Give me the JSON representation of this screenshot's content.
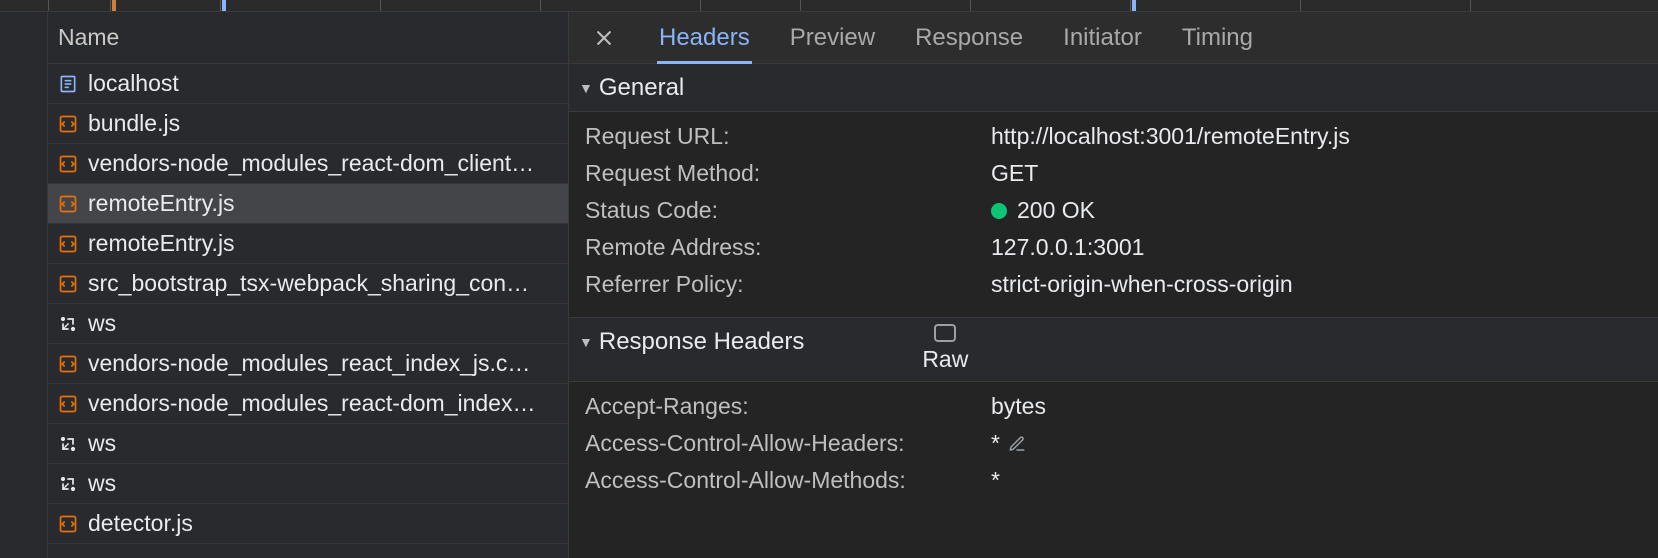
{
  "namePanel": {
    "header": "Name",
    "items": [
      {
        "label": "localhost",
        "icon": "doc",
        "selected": false
      },
      {
        "label": "bundle.js",
        "icon": "script",
        "selected": false
      },
      {
        "label": "vendors-node_modules_react-dom_client…",
        "icon": "script",
        "selected": false
      },
      {
        "label": "remoteEntry.js",
        "icon": "script",
        "selected": true
      },
      {
        "label": "remoteEntry.js",
        "icon": "script",
        "selected": false
      },
      {
        "label": "src_bootstrap_tsx-webpack_sharing_con…",
        "icon": "script",
        "selected": false
      },
      {
        "label": "ws",
        "icon": "ws",
        "selected": false
      },
      {
        "label": "vendors-node_modules_react_index_js.c…",
        "icon": "script",
        "selected": false
      },
      {
        "label": "vendors-node_modules_react-dom_index…",
        "icon": "script",
        "selected": false
      },
      {
        "label": "ws",
        "icon": "ws",
        "selected": false
      },
      {
        "label": "ws",
        "icon": "ws",
        "selected": false
      },
      {
        "label": "detector.js",
        "icon": "script",
        "selected": false
      }
    ]
  },
  "tabs": {
    "items": [
      "Headers",
      "Preview",
      "Response",
      "Initiator",
      "Timing"
    ],
    "activeIndex": 0
  },
  "general": {
    "title": "General",
    "rows": [
      {
        "k": "Request URL:",
        "v": "http://localhost:3001/remoteEntry.js"
      },
      {
        "k": "Request Method:",
        "v": "GET"
      },
      {
        "k": "Status Code:",
        "v": "200 OK",
        "status": true
      },
      {
        "k": "Remote Address:",
        "v": "127.0.0.1:3001"
      },
      {
        "k": "Referrer Policy:",
        "v": "strict-origin-when-cross-origin"
      }
    ]
  },
  "responseHeaders": {
    "title": "Response Headers",
    "rawLabel": "Raw",
    "rows": [
      {
        "k": "Accept-Ranges:",
        "v": "bytes"
      },
      {
        "k": "Access-Control-Allow-Headers:",
        "v": "*",
        "editable": true
      },
      {
        "k": "Access-Control-Allow-Methods:",
        "v": "*"
      }
    ]
  }
}
